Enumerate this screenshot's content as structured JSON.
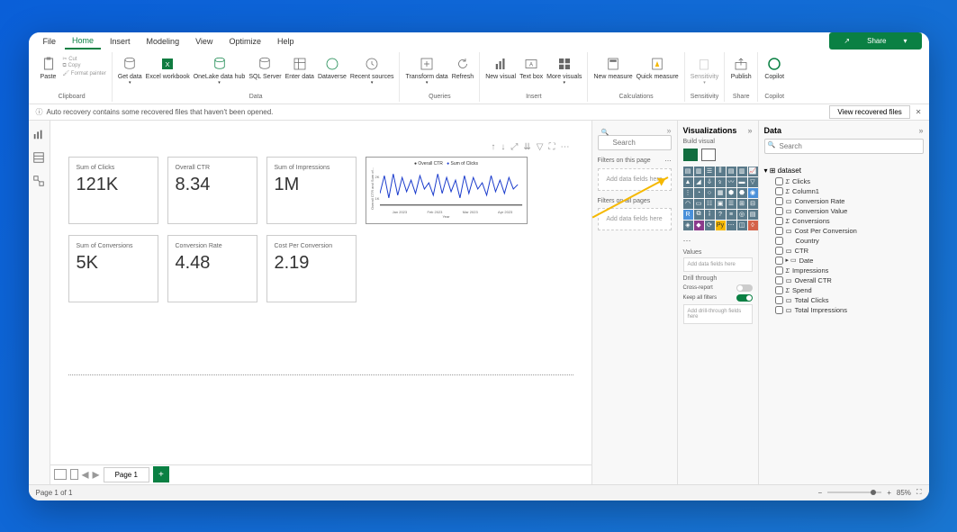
{
  "menubar": {
    "items": [
      "File",
      "Home",
      "Insert",
      "Modeling",
      "View",
      "Optimize",
      "Help"
    ],
    "active": 1,
    "share": "Share"
  },
  "ribbon": {
    "clipboard": {
      "label": "Clipboard",
      "cut": "Cut",
      "copy": "Copy",
      "paint": "Format painter",
      "paste": "Paste"
    },
    "data": {
      "label": "Data",
      "get": "Get data",
      "excel": "Excel workbook",
      "onelake": "OneLake data hub",
      "sql": "SQL Server",
      "enter": "Enter data",
      "dataverse": "Dataverse",
      "recent": "Recent sources"
    },
    "queries": {
      "label": "Queries",
      "transform": "Transform data",
      "refresh": "Refresh"
    },
    "insert": {
      "label": "Insert",
      "newvis": "New visual",
      "textbox": "Text box",
      "more": "More visuals"
    },
    "calc": {
      "label": "Calculations",
      "newmeasure": "New measure",
      "quickmeasure": "Quick measure"
    },
    "sensitivity": {
      "label": "Sensitivity",
      "item": "Sensitivity"
    },
    "share": {
      "label": "Share",
      "publish": "Publish"
    },
    "copilot": {
      "label": "Copilot",
      "item": "Copilot"
    }
  },
  "recovery": {
    "text": "Auto recovery contains some recovered files that haven't been opened.",
    "button": "View recovered files"
  },
  "filters": {
    "search_placeholder": "Search",
    "page_title": "Filters on this page",
    "all_title": "Filters on all pages",
    "drop": "Add data fields here"
  },
  "viz": {
    "title": "Visualizations",
    "subtitle": "Build visual",
    "values": "Values",
    "drop": "Add data fields here",
    "drill": "Drill through",
    "cross": "Cross-report",
    "keep": "Keep all filters",
    "drillthrough_drop": "Add drill-through fields here"
  },
  "data": {
    "title": "Data",
    "search_placeholder": "Search",
    "dataset": "dataset",
    "fields": [
      "Clicks",
      "Column1",
      "Conversion Rate",
      "Conversion Value",
      "Conversions",
      "Cost Per Conversion",
      "Country",
      "CTR",
      "Date",
      "Impressions",
      "Overall CTR",
      "Spend",
      "Total Clicks",
      "Total Impressions"
    ],
    "field_types": [
      "sigma",
      "sigma",
      "calc",
      "calc",
      "sigma",
      "calc",
      "",
      "calc",
      "date",
      "sigma",
      "calc",
      "sigma",
      "calc",
      "calc"
    ]
  },
  "cards": [
    {
      "label": "Sum of Clicks",
      "value": "121K"
    },
    {
      "label": "Overall CTR",
      "value": "8.34"
    },
    {
      "label": "Sum of Impressions",
      "value": "1M"
    },
    {
      "label": "Sum of Conversions",
      "value": "5K"
    },
    {
      "label": "Conversion Rate",
      "value": "4.48"
    },
    {
      "label": "Cost Per Conversion",
      "value": "2.19"
    }
  ],
  "chart_data": {
    "type": "line",
    "title": "",
    "series": [
      {
        "name": "Overall CTR"
      },
      {
        "name": "Sum of Clicks"
      }
    ],
    "xlabel": "Year",
    "ylabel": "Overall CTR and Sum of...",
    "x_ticks": [
      "Jan 2023",
      "Feb 2023",
      "Mar 2023",
      "Apr 2023"
    ],
    "y_ticks": [
      "1K",
      "2K"
    ],
    "ylim": [
      0,
      2500
    ]
  },
  "pages": {
    "tab": "Page 1",
    "status": "Page 1 of 1",
    "zoom": "85%"
  }
}
